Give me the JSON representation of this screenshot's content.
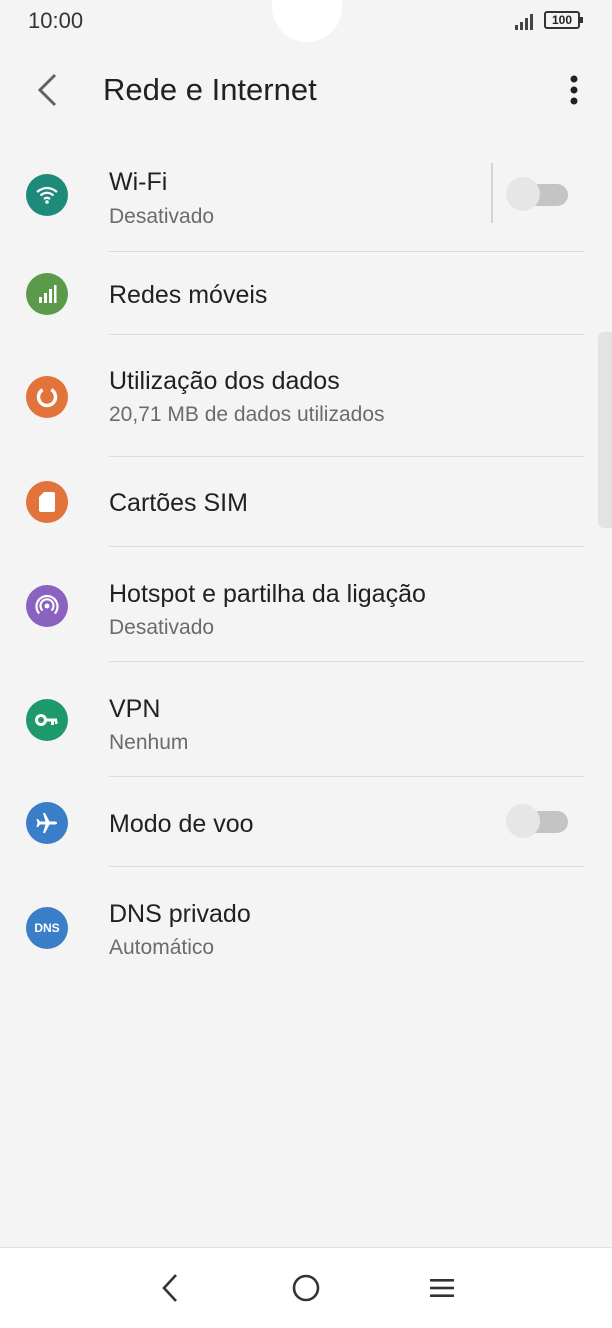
{
  "status_bar": {
    "time": "10:00",
    "battery": "100"
  },
  "app_bar": {
    "title": "Rede e Internet",
    "back_icon": "back-arrow-icon",
    "more_icon": "more-vert-icon"
  },
  "items": [
    {
      "key": "wifi",
      "title": "Wi-Fi",
      "subtitle": "Desativado",
      "icon": "wifi-icon",
      "icon_color": "#1e8a7a",
      "toggle": false
    },
    {
      "key": "mobile",
      "title": "Redes móveis",
      "subtitle": null,
      "icon": "signal-bars-icon",
      "icon_color": "#5a9a4a"
    },
    {
      "key": "data",
      "title": "Utilização dos dados",
      "subtitle": "20,71 MB de dados utilizados",
      "icon": "data-usage-icon",
      "icon_color": "#e2733a"
    },
    {
      "key": "sim",
      "title": "Cartões SIM",
      "subtitle": null,
      "icon": "sim-card-icon",
      "icon_color": "#e2733a"
    },
    {
      "key": "hotspot",
      "title": "Hotspot e partilha da ligação",
      "subtitle": "Desativado",
      "icon": "hotspot-icon",
      "icon_color": "#8a62c0"
    },
    {
      "key": "vpn",
      "title": "VPN",
      "subtitle": "Nenhum",
      "icon": "key-icon",
      "icon_color": "#1e9a6a"
    },
    {
      "key": "airplane",
      "title": "Modo de voo",
      "subtitle": null,
      "icon": "airplane-icon",
      "icon_color": "#3a7ec8",
      "toggle": false
    },
    {
      "key": "dns",
      "title": "DNS privado",
      "subtitle": "Automático",
      "icon": "dns-icon",
      "icon_label": "DNS",
      "icon_color": "#3a7ec8"
    }
  ],
  "nav_bar": {
    "back_icon": "nav-back-icon",
    "home_icon": "nav-home-icon",
    "menu_icon": "nav-menu-icon"
  }
}
